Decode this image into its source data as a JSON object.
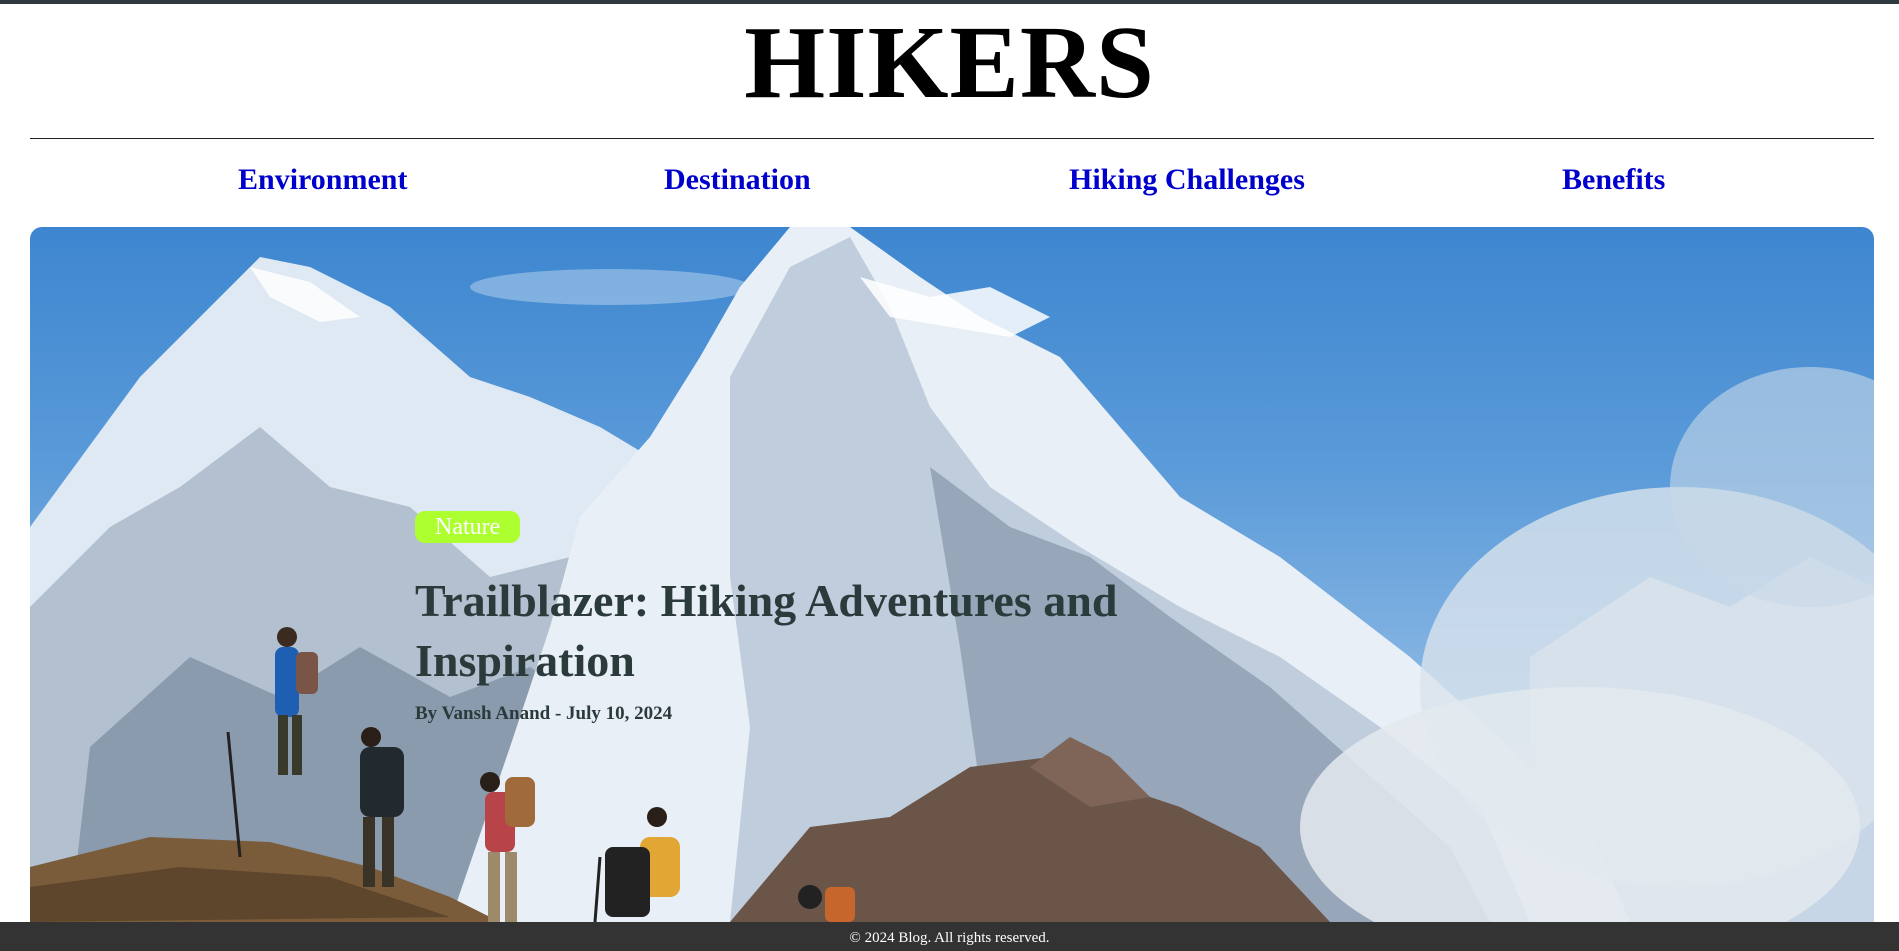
{
  "header": {
    "site_title": "HIKERS"
  },
  "nav": {
    "items": [
      {
        "label": "Environment"
      },
      {
        "label": "Destination"
      },
      {
        "label": "Hiking Challenges"
      },
      {
        "label": "Benefits"
      }
    ],
    "link_color": "#0000cc"
  },
  "hero": {
    "image_subject": "hikers-below-snowy-mountain",
    "tag": "Nature",
    "tag_color": "#adff2f",
    "title": "Trailblazer: Hiking Adventures and Inspiration",
    "byline": "By Vansh Anand - July 10, 2024"
  },
  "footer": {
    "copyright": "© 2024 Blog. All rights reserved."
  }
}
